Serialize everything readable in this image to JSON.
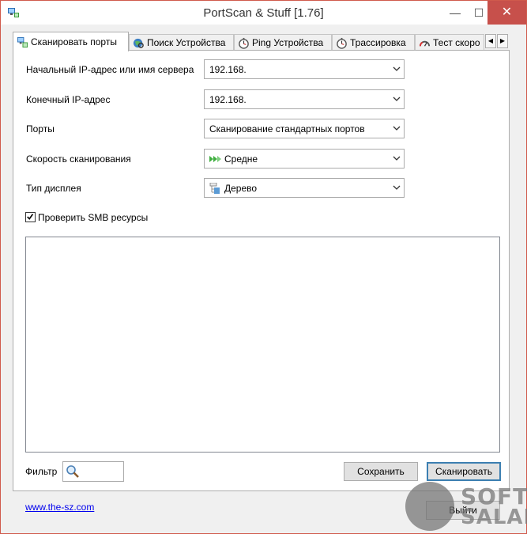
{
  "window": {
    "title": "PortScan & Stuff [1.76]",
    "minimize_glyph": "—",
    "maximize_glyph": "☐",
    "close_glyph": "✕"
  },
  "tabs": [
    {
      "label": "Сканировать порты",
      "icon": "network-computer-icon",
      "active": true
    },
    {
      "label": "Поиск Устройства",
      "icon": "globe-search-icon",
      "active": false
    },
    {
      "label": "Ping Устройства",
      "icon": "stopwatch-icon",
      "active": false
    },
    {
      "label": "Трассировка",
      "icon": "stopwatch-icon",
      "active": false
    },
    {
      "label": "Тест скоро",
      "icon": "speedometer-icon",
      "active": false
    }
  ],
  "tab_scroll": {
    "left": "◀",
    "right": "▶"
  },
  "form": {
    "start_ip_label": "Начальный IP-адрес или имя сервера",
    "start_ip_value": "192.168.",
    "end_ip_label": "Конечный IP-адрес",
    "end_ip_value": "192.168.",
    "ports_label": "Порты",
    "ports_value": "Сканирование стандартных портов",
    "speed_label": "Скорость сканирования",
    "speed_value": "Средне",
    "display_label": "Тип дисплея",
    "display_value": "Дерево",
    "smb_label": "Проверить SMB ресурсы",
    "smb_checked": true
  },
  "bottom": {
    "filter_label": "Фильтр",
    "save_label": "Сохранить",
    "scan_label": "Сканировать"
  },
  "footer": {
    "link_text": "www.the-sz.com",
    "exit_label": "Выйти"
  },
  "watermark": {
    "line1": "SOFT",
    "line2": "SALAD"
  },
  "colors": {
    "accent": "#3c7fb1",
    "close": "#c7504b",
    "link": "#0000ee"
  }
}
